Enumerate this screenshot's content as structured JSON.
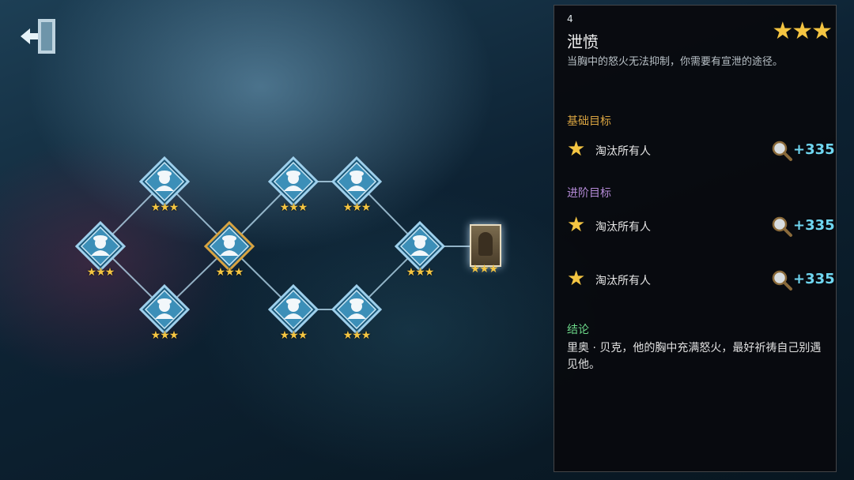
{
  "level": {
    "number": "4",
    "title": "泄愤",
    "stars": "★★★",
    "description": "当胸中的怒火无法抑制，你需要有宣泄的途径。"
  },
  "basic": {
    "heading": "基础目标",
    "objectives": [
      {
        "star": "★",
        "text": "淘汰所有人",
        "reward": "+335",
        "icon": "magnifier-icon"
      }
    ]
  },
  "advanced": {
    "heading": "进阶目标",
    "objectives": [
      {
        "star": "★",
        "text": "淘汰所有人",
        "reward": "+335",
        "icon": "magnifier-icon"
      },
      {
        "star": "★",
        "text": "淘汰所有人",
        "reward": "+335",
        "icon": "magnifier-icon"
      }
    ]
  },
  "conclusion": {
    "heading": "结论",
    "text": "里奥 · 贝克，他的胸中充满怒火，最好祈祷自己别遇见他。"
  },
  "map": {
    "node_stars": "★★★",
    "selected_level": 4,
    "nodes": [
      {
        "id": 1,
        "icon": "detective-icon",
        "stars": 3
      },
      {
        "id": 2,
        "icon": "detective-icon",
        "stars": 3
      },
      {
        "id": 3,
        "icon": "detective-icon",
        "stars": 3
      },
      {
        "id": 4,
        "icon": "detective-icon",
        "stars": 3
      },
      {
        "id": 5,
        "icon": "detective-icon",
        "stars": 3
      },
      {
        "id": 6,
        "icon": "detective-icon",
        "stars": 3
      },
      {
        "id": 7,
        "icon": "detective-icon",
        "stars": 3
      },
      {
        "id": 8,
        "icon": "detective-icon",
        "stars": 3
      },
      {
        "id": 9,
        "icon": "detective-icon",
        "stars": 3
      },
      {
        "id": 10,
        "icon": "hunter-portrait",
        "stars": 3
      }
    ]
  },
  "colors": {
    "accent_gold": "#d9a441",
    "advanced_purple": "#b58bd8",
    "conclusion_green": "#6dd98a",
    "reward_cyan": "#6fd6f0",
    "star": "#f4c542"
  },
  "icons": {
    "exit": "exit-door-icon"
  }
}
